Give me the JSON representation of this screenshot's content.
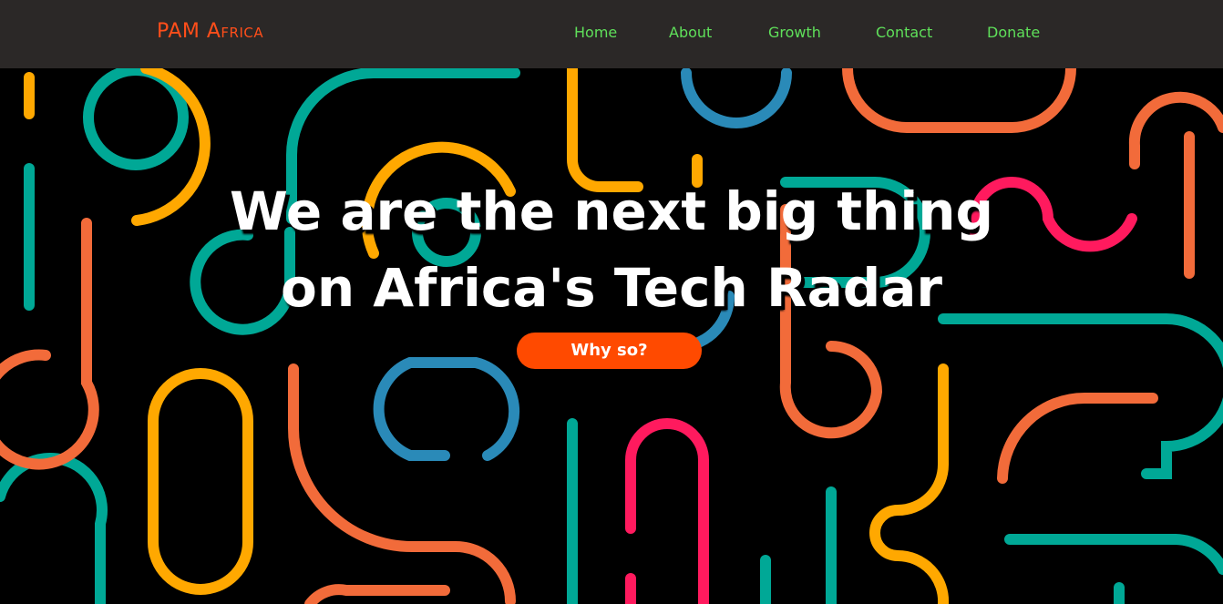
{
  "nav": {
    "brand": "PAM Africa",
    "links": [
      {
        "label": "Home"
      },
      {
        "label": "About"
      },
      {
        "label": "Growth"
      },
      {
        "label": "Contact"
      },
      {
        "label": "Donate"
      }
    ]
  },
  "hero": {
    "headline_line1": "We are the next big thing",
    "headline_line2": "on Africa's Tech Radar",
    "cta_label": "Why so?"
  },
  "colors": {
    "navbar_bg": "#2b2827",
    "brand": "#ff4e1a",
    "nav_link": "#5fe05a",
    "cta_bg": "#ff4a00",
    "pattern_teal": "#00a896",
    "pattern_orange": "#f26b3a",
    "pattern_yellow": "#ffa800",
    "pattern_blue": "#2a8ab8",
    "pattern_pink": "#ff1a5e"
  }
}
